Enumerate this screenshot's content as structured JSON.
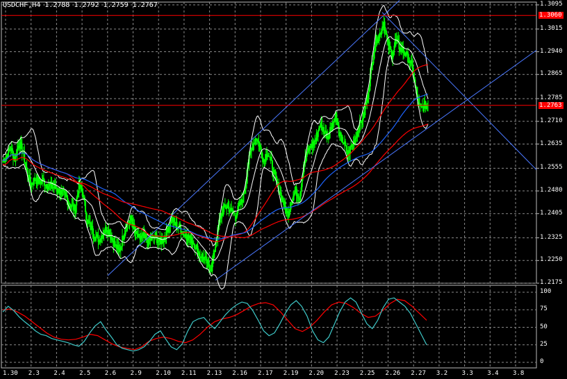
{
  "header": {
    "title": "USDCHF,H4  1.2788 1.2792 1.2759 1.2767"
  },
  "colors": {
    "background": "#000000",
    "grid": "#8a8a8a",
    "candles": "#00ff00",
    "bollinger": "#ffffff",
    "ma_red": "#ff0000",
    "ma_blue": "#1e64ff",
    "trendlines": "#4a78ff",
    "level_lines": "#ff0000",
    "stoch_main": "#3ec9c9",
    "stoch_signal": "#ff0000"
  },
  "price_axis": {
    "ticks": [
      "1.3095",
      "1.3015",
      "1.2940",
      "1.2865",
      "1.2785",
      "1.2710",
      "1.2635",
      "1.2555",
      "1.2480",
      "1.2405",
      "1.2325",
      "1.2250",
      "1.2175"
    ],
    "range": [
      1.2175,
      1.3095
    ]
  },
  "price_tags": [
    {
      "label": "1.3060",
      "value": 1.306
    },
    {
      "label": "1.2763",
      "value": 1.2763
    }
  ],
  "oscillator": {
    "levels": [
      "100",
      "75",
      "50",
      "25",
      "0"
    ]
  },
  "time_axis": {
    "labels": [
      "1.30",
      "2.3",
      "2.4",
      "2.5",
      "2.6",
      "2.9",
      "2.10",
      "2.11",
      "2.13",
      "2.16",
      "2.17",
      "2.19",
      "2.20",
      "2.23",
      "2.25",
      "2.26",
      "2.27",
      "3.2",
      "3.3",
      "3.4",
      "3.8"
    ]
  },
  "chart_data": {
    "type": "candlestick",
    "symbol": "USDCHF",
    "timeframe": "H4",
    "ohlc_last": {
      "open": 1.2788,
      "high": 1.2792,
      "low": 1.2759,
      "close": 1.2767
    },
    "close_path": [
      1.258,
      1.26,
      1.262,
      1.2585,
      1.264,
      1.261,
      1.2545,
      1.25,
      1.252,
      1.251,
      1.2515,
      1.25,
      1.2495,
      1.249,
      1.248,
      1.247,
      1.2455,
      1.243,
      1.242,
      1.25,
      1.247,
      1.238,
      1.236,
      1.233,
      1.232,
      1.234,
      1.236,
      1.233,
      1.23,
      1.228,
      1.233,
      1.237,
      1.239,
      1.234,
      1.232,
      1.233,
      1.231,
      1.232,
      1.233,
      1.231,
      1.232,
      1.235,
      1.239,
      1.237,
      1.236,
      1.234,
      1.233,
      1.232,
      1.23,
      1.227,
      1.226,
      1.224,
      1.2225,
      1.23,
      1.238,
      1.242,
      1.243,
      1.241,
      1.24,
      1.243,
      1.246,
      1.256,
      1.262,
      1.266,
      1.263,
      1.258,
      1.261,
      1.257,
      1.252,
      1.248,
      1.244,
      1.24,
      1.245,
      1.248,
      1.246,
      1.257,
      1.261,
      1.263,
      1.265,
      1.27,
      1.268,
      1.266,
      1.27,
      1.273,
      1.266,
      1.264,
      1.26,
      1.263,
      1.266,
      1.27,
      1.273,
      1.28,
      1.29,
      1.298,
      1.3,
      1.304,
      1.296,
      1.293,
      1.298,
      1.295,
      1.294,
      1.292,
      1.289,
      1.281,
      1.275,
      1.276,
      1.2767
    ],
    "stoch_main": [
      72,
      80,
      74,
      65,
      58,
      52,
      45,
      40,
      38,
      34,
      32,
      30,
      28,
      25,
      23,
      30,
      42,
      52,
      58,
      46,
      36,
      25,
      20,
      18,
      16,
      18,
      22,
      30,
      40,
      45,
      33,
      22,
      18,
      26,
      44,
      58,
      62,
      64,
      55,
      48,
      58,
      68,
      76,
      82,
      86,
      84,
      74,
      60,
      45,
      38,
      42,
      55,
      70,
      82,
      88,
      80,
      66,
      45,
      32,
      28,
      36,
      54,
      72,
      86,
      92,
      86,
      70,
      55,
      48,
      60,
      78,
      90,
      92,
      86,
      80,
      70,
      55,
      40,
      25
    ],
    "stoch_signal": [
      75,
      76,
      72,
      66,
      58,
      50,
      42,
      36,
      33,
      32,
      33,
      36,
      40,
      38,
      32,
      26,
      22,
      20,
      18,
      22,
      30,
      34,
      36,
      34,
      30,
      28,
      32,
      40,
      50,
      58,
      62,
      64,
      68,
      74,
      80,
      84,
      85,
      82,
      72,
      60,
      48,
      44,
      50,
      60,
      72,
      82,
      86,
      84,
      78,
      70,
      64,
      66,
      74,
      84,
      90,
      88,
      80,
      70,
      60
    ]
  }
}
